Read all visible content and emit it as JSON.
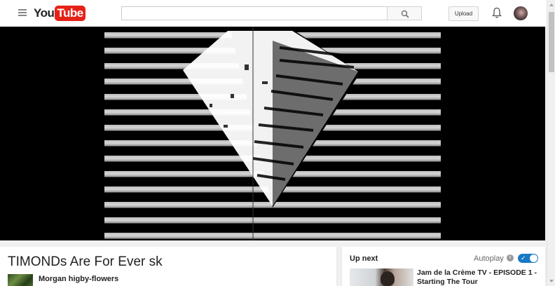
{
  "masthead": {
    "logo_you": "You",
    "logo_tube": "Tube",
    "search_value": "",
    "upload_label": "Upload"
  },
  "video": {
    "title": "TIMONDs Are For Ever sk",
    "channel": "Morgan higby-flowers"
  },
  "up_next": {
    "label": "Up next",
    "autoplay_label": "Autoplay",
    "autoplay_on": true,
    "info_glyph": "i",
    "toggle_glyph": "✓",
    "next_video_title": "Jam de la Crème TV - EPISODE 1 - Starting The Tour"
  },
  "icons": {
    "menu": "hamburger-menu-icon",
    "search": "search-icon",
    "notifications": "bell-icon",
    "info": "info-icon"
  },
  "colors": {
    "brand_red": "#e62117",
    "toggle_blue": "#167ac6",
    "player_bg": "#000000"
  }
}
